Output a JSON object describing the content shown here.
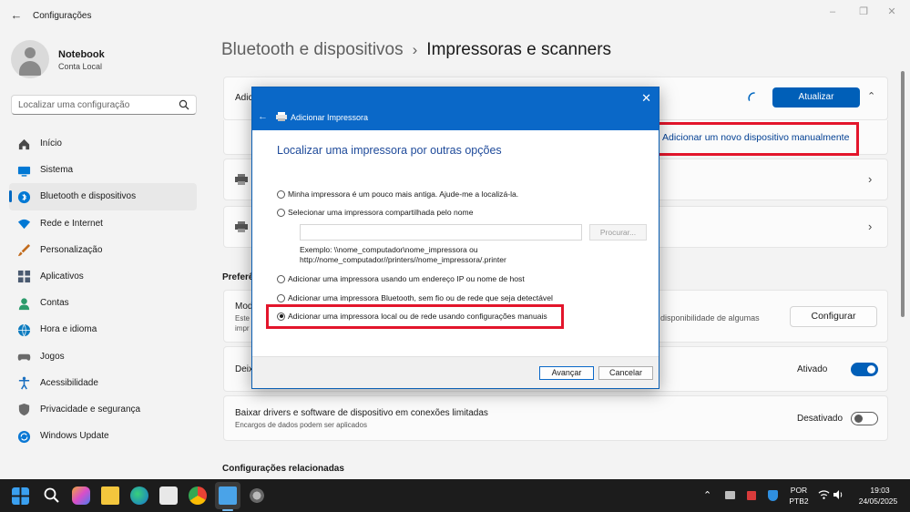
{
  "app": {
    "title": "Configurações"
  },
  "profile": {
    "name": "Notebook",
    "account": "Conta Local"
  },
  "search": {
    "placeholder": "Localizar uma configuração"
  },
  "nav": [
    {
      "label": "Início",
      "icon": "home-icon",
      "color": "#4a4a4a"
    },
    {
      "label": "Sistema",
      "icon": "monitor-icon",
      "color": "#0078d4"
    },
    {
      "label": "Bluetooth e dispositivos",
      "icon": "bluetooth-icon",
      "color": "#0078d4",
      "active": true
    },
    {
      "label": "Rede e Internet",
      "icon": "wifi-icon",
      "color": "#0078d4"
    },
    {
      "label": "Personalização",
      "icon": "brush-icon",
      "color": "#c26b1c"
    },
    {
      "label": "Aplicativos",
      "icon": "apps-icon",
      "color": "#4a5a70"
    },
    {
      "label": "Contas",
      "icon": "person-icon",
      "color": "#2b9b6b"
    },
    {
      "label": "Hora e idioma",
      "icon": "globe-icon",
      "color": "#0a7abf"
    },
    {
      "label": "Jogos",
      "icon": "gamepad-icon",
      "color": "#6a6a6a"
    },
    {
      "label": "Acessibilidade",
      "icon": "accessibility-icon",
      "color": "#1a6fc0"
    },
    {
      "label": "Privacidade e segurança",
      "icon": "shield-icon",
      "color": "#6a6a6a"
    },
    {
      "label": "Windows Update",
      "icon": "update-icon",
      "color": "#0a78d4"
    }
  ],
  "breadcrumb": {
    "parent": "Bluetooth e dispositivos",
    "separator": "›",
    "current": "Impressoras e scanners"
  },
  "main": {
    "add_card_label_partial": "Adici",
    "refresh_button": "Atualizar",
    "add_manual_link": "Adicionar um novo dispositivo manualmente",
    "preferences_title_partial": "Preferê",
    "mode_card": {
      "title_partial": "Mod",
      "desc_line1_partial": "Este",
      "desc_line2_partial": "impr",
      "desc_right": "disponibilidade de algumas",
      "button": "Configurar"
    },
    "default_card": {
      "title_partial": "Deix",
      "toggle_state": "Ativado",
      "toggle_on": true
    },
    "metered_card": {
      "title": "Baixar drivers e software de dispositivo em conexões limitadas",
      "desc": "Encargos de dados podem ser aplicados",
      "toggle_state": "Desativado",
      "toggle_on": false
    },
    "related_title": "Configurações relacionadas"
  },
  "dialog": {
    "title": "Adicionar Impressora",
    "heading": "Localizar uma impressora por outras opções",
    "options": [
      {
        "label": "Minha impressora é um pouco mais antiga. Ajude-me a localizá-la.",
        "checked": false
      },
      {
        "label": "Selecionar uma impressora compartilhada pelo nome",
        "checked": false
      },
      {
        "label": "Adicionar uma impressora usando um endereço IP ou nome de host",
        "checked": false
      },
      {
        "label": "Adicionar uma impressora Bluetooth, sem fio ou de rede que seja detectável",
        "checked": false
      },
      {
        "label": "Adicionar uma impressora local ou de rede usando configurações manuais",
        "checked": true
      }
    ],
    "browse_button": "Procurar...",
    "example_line1": "Exemplo: \\\\nome_computador\\nome_impressora ou",
    "example_line2": "http://nome_computador//printers//nome_impressora/.printer",
    "next_button": "Avançar",
    "cancel_button": "Cancelar"
  },
  "taskbar": {
    "language": "POR",
    "layout": "PTB2",
    "time": "19:03",
    "date": "24/05/2025"
  },
  "colors": {
    "accent": "#005fb8",
    "highlight_box": "#e3152b",
    "dialog_header": "#0a68c8"
  }
}
